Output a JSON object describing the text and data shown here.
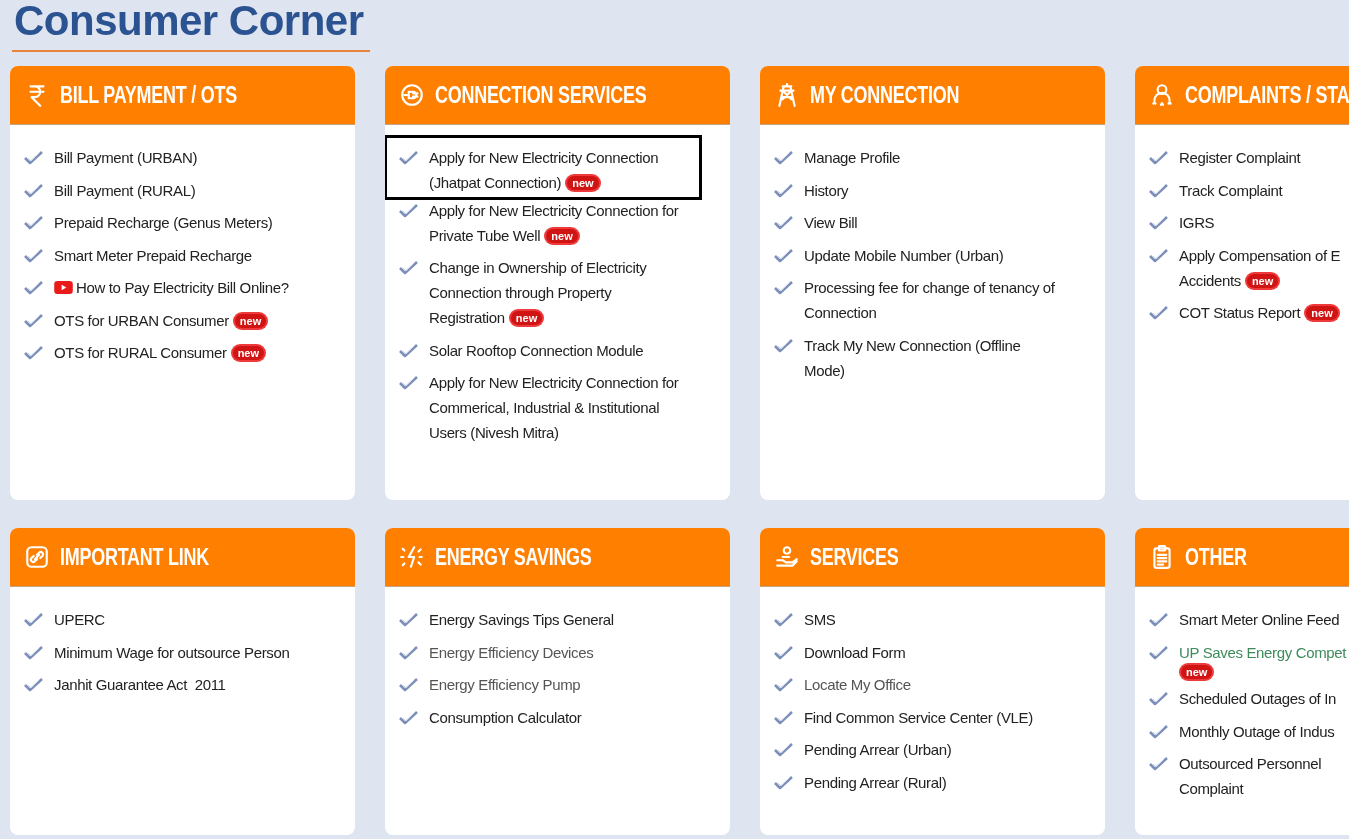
{
  "title": "Consumer Corner",
  "cards": [
    {
      "title": "BILL PAYMENT / OTS",
      "items": [
        {
          "text": "Bill Payment (URBAN)",
          "color": "#222222"
        },
        {
          "text": "Bill Payment (RURAL)",
          "color": "#222222"
        },
        {
          "text": "Prepaid Recharge (Genus Meters)",
          "color": "#222222"
        },
        {
          "text": "Smart Meter Prepaid Recharge",
          "color": "#222222"
        },
        {
          "text": "How to Pay Electricity Bill Online?",
          "color": "#222222",
          "kind": "video"
        },
        {
          "text": "OTS for URBAN Consumer",
          "color": "#222222",
          "badge": "new"
        },
        {
          "text": "OTS for RURAL Consumer",
          "color": "#222222",
          "badge": "new"
        }
      ]
    },
    {
      "title": "CONNECTION SERVICES",
      "items": [
        {
          "text": "Apply for New Electricity Connection\n(Jhatpat Connection)",
          "color": "#222222",
          "badge": "new",
          "highlighted": true
        },
        {
          "text": "Apply for New Electricity Connection for\nPrivate Tube Well",
          "color": "#222222",
          "badge": "new"
        },
        {
          "text": "Change in Ownership of Electricity\nConnection through Property\nRegistration",
          "color": "#222222",
          "badge": "new"
        },
        {
          "text": "Solar Rooftop Connection Module",
          "color": "#222222"
        },
        {
          "text": "Apply for New Electricity Connection for\nCommerical, Industrial & Institutional\nUsers (Nivesh Mitra)",
          "color": "#222222"
        }
      ]
    },
    {
      "title": "MY CONNECTION",
      "items": [
        {
          "text": "Manage Profile",
          "color": "#222222"
        },
        {
          "text": "History",
          "color": "#222222"
        },
        {
          "text": "View Bill",
          "color": "#222222"
        },
        {
          "text": "Update Mobile Number (Urban)",
          "color": "#222222"
        },
        {
          "text": "Processing fee for change of tenancy of\nConnection",
          "color": "#222222"
        },
        {
          "text": "Track My New Connection (Offline\nMode)",
          "color": "#222222"
        }
      ]
    },
    {
      "title": "COMPLAINTS / STA",
      "items": [
        {
          "text": "Register Complaint",
          "color": "#222222"
        },
        {
          "text": "Track Complaint",
          "color": "#222222"
        },
        {
          "text": "IGRS",
          "color": "#222222"
        },
        {
          "text": "Apply Compensation of E\nAccidents",
          "color": "#222222",
          "badge": "new"
        },
        {
          "text": "COT Status Report",
          "color": "#222222",
          "badge": "new"
        }
      ]
    },
    {
      "title": "IMPORTANT LINK",
      "items": [
        {
          "text": "UPERC",
          "color": "#222222"
        },
        {
          "text": "Minimum Wage for outsource Person",
          "color": "#222222"
        },
        {
          "text": "Janhit Guarantee Act  2011",
          "color": "#222222"
        }
      ]
    },
    {
      "title": "ENERGY SAVINGS",
      "items": [
        {
          "text": "Energy Savings Tips General",
          "color": "#222222"
        },
        {
          "text": "Energy Efficiency Devices",
          "color": "#555555"
        },
        {
          "text": "Energy Efficiency Pump",
          "color": "#555555"
        },
        {
          "text": "Consumption Calculator",
          "color": "#222222"
        }
      ]
    },
    {
      "title": "SERVICES",
      "items": [
        {
          "text": "SMS",
          "color": "#222222"
        },
        {
          "text": "Download Form",
          "color": "#222222"
        },
        {
          "text": "Locate My Office",
          "color": "#555555"
        },
        {
          "text": "Find Common Service Center (VLE)",
          "color": "#222222"
        },
        {
          "text": "Pending Arrear (Urban)",
          "color": "#222222"
        },
        {
          "text": "Pending Arrear (Rural)",
          "color": "#222222"
        }
      ]
    },
    {
      "title": "OTHER",
      "items": [
        {
          "text": "Smart Meter Online Feed",
          "color": "#222222"
        },
        {
          "text": "UP Saves Energy Compet",
          "color": "#3d8b5a",
          "badge": "new",
          "badge_below": true
        },
        {
          "text": "Scheduled Outages of In",
          "color": "#222222"
        },
        {
          "text": "Monthly Outage of Indus",
          "color": "#222222"
        },
        {
          "text": "Outsourced Personnel\nComplaint",
          "color": "#222222"
        }
      ]
    }
  ]
}
